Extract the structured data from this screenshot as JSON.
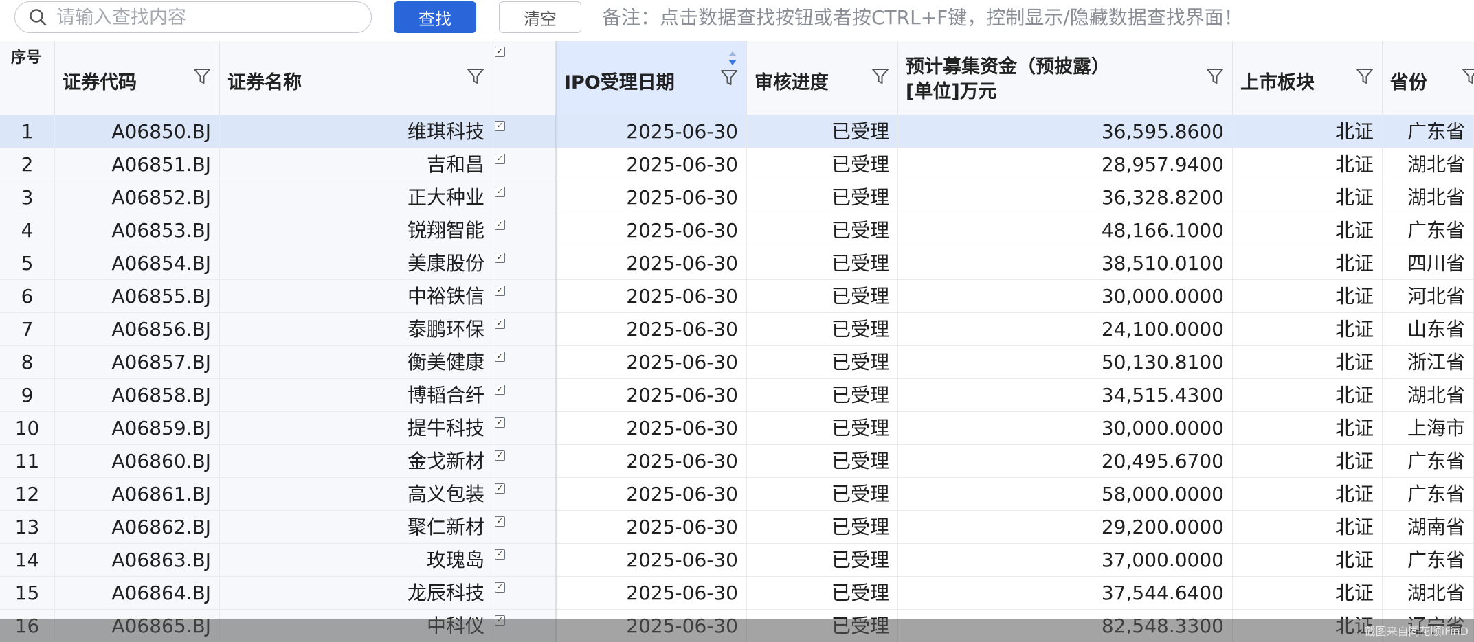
{
  "search": {
    "placeholder": "请输入查找内容",
    "find_label": "查找",
    "clear_label": "清空",
    "note": "备注：点击数据查找按钮或者按CTRL+F键，控制显示/隐藏数据查找界面！"
  },
  "table": {
    "headers": {
      "seq": "序号",
      "code": "证券代码",
      "name": "证券名称",
      "ipo_date": "IPO受理日期",
      "progress": "审核进度",
      "funds_line1": "预计募集资金（预披露）",
      "funds_line2": "[单位]万元",
      "board": "上市板块",
      "province": "省份"
    },
    "rows": [
      {
        "seq": "1",
        "code": "A06850.BJ",
        "name": "维琪科技",
        "date": "2025-06-30",
        "progress": "已受理",
        "funds": "36,595.8600",
        "board": "北证",
        "province": "广东省"
      },
      {
        "seq": "2",
        "code": "A06851.BJ",
        "name": "吉和昌",
        "date": "2025-06-30",
        "progress": "已受理",
        "funds": "28,957.9400",
        "board": "北证",
        "province": "湖北省"
      },
      {
        "seq": "3",
        "code": "A06852.BJ",
        "name": "正大种业",
        "date": "2025-06-30",
        "progress": "已受理",
        "funds": "36,328.8200",
        "board": "北证",
        "province": "湖北省"
      },
      {
        "seq": "4",
        "code": "A06853.BJ",
        "name": "锐翔智能",
        "date": "2025-06-30",
        "progress": "已受理",
        "funds": "48,166.1000",
        "board": "北证",
        "province": "广东省"
      },
      {
        "seq": "5",
        "code": "A06854.BJ",
        "name": "美康股份",
        "date": "2025-06-30",
        "progress": "已受理",
        "funds": "38,510.0100",
        "board": "北证",
        "province": "四川省"
      },
      {
        "seq": "6",
        "code": "A06855.BJ",
        "name": "中裕铁信",
        "date": "2025-06-30",
        "progress": "已受理",
        "funds": "30,000.0000",
        "board": "北证",
        "province": "河北省"
      },
      {
        "seq": "7",
        "code": "A06856.BJ",
        "name": "泰鹏环保",
        "date": "2025-06-30",
        "progress": "已受理",
        "funds": "24,100.0000",
        "board": "北证",
        "province": "山东省"
      },
      {
        "seq": "8",
        "code": "A06857.BJ",
        "name": "衡美健康",
        "date": "2025-06-30",
        "progress": "已受理",
        "funds": "50,130.8100",
        "board": "北证",
        "province": "浙江省"
      },
      {
        "seq": "9",
        "code": "A06858.BJ",
        "name": "博韬合纤",
        "date": "2025-06-30",
        "progress": "已受理",
        "funds": "34,515.4300",
        "board": "北证",
        "province": "湖北省"
      },
      {
        "seq": "10",
        "code": "A06859.BJ",
        "name": "提牛科技",
        "date": "2025-06-30",
        "progress": "已受理",
        "funds": "30,000.0000",
        "board": "北证",
        "province": "上海市"
      },
      {
        "seq": "11",
        "code": "A06860.BJ",
        "name": "金戈新材",
        "date": "2025-06-30",
        "progress": "已受理",
        "funds": "20,495.6700",
        "board": "北证",
        "province": "广东省"
      },
      {
        "seq": "12",
        "code": "A06861.BJ",
        "name": "高义包装",
        "date": "2025-06-30",
        "progress": "已受理",
        "funds": "58,000.0000",
        "board": "北证",
        "province": "广东省"
      },
      {
        "seq": "13",
        "code": "A06862.BJ",
        "name": "聚仁新材",
        "date": "2025-06-30",
        "progress": "已受理",
        "funds": "29,200.0000",
        "board": "北证",
        "province": "湖南省"
      },
      {
        "seq": "14",
        "code": "A06863.BJ",
        "name": "玫瑰岛",
        "date": "2025-06-30",
        "progress": "已受理",
        "funds": "37,000.0000",
        "board": "北证",
        "province": "广东省"
      },
      {
        "seq": "15",
        "code": "A06864.BJ",
        "name": "龙辰科技",
        "date": "2025-06-30",
        "progress": "已受理",
        "funds": "37,544.6400",
        "board": "北证",
        "province": "湖北省"
      },
      {
        "seq": "16",
        "code": "A06865.BJ",
        "name": "中科仪",
        "date": "2025-06-30",
        "progress": "已受理",
        "funds": "82,548.3300",
        "board": "北证",
        "province": "辽宁省"
      }
    ]
  },
  "watermark": "截图来自同花顺iFinD",
  "colors": {
    "accent": "#2a66d9",
    "sorted_header": "#dfeaff",
    "selected_row": "#dde8fb",
    "sort_arrow": "#3a78e0"
  }
}
